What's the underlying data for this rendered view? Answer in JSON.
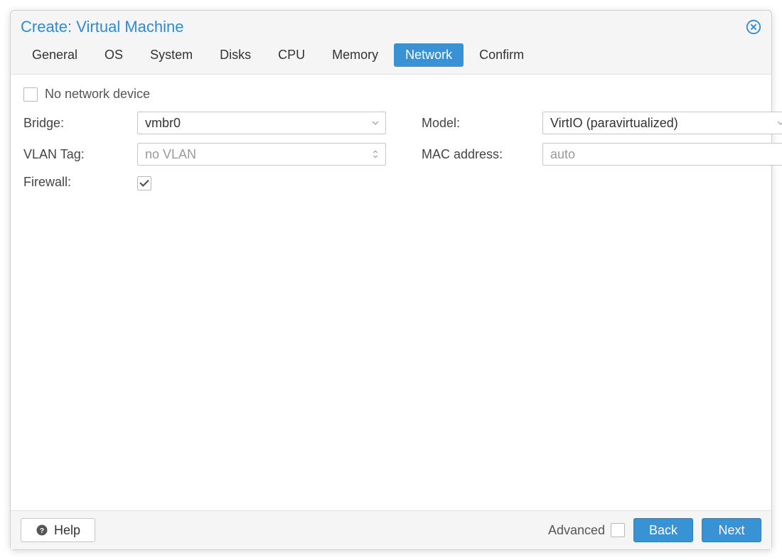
{
  "dialog": {
    "title": "Create: Virtual Machine"
  },
  "tabs": {
    "general": "General",
    "os": "OS",
    "system": "System",
    "disks": "Disks",
    "cpu": "CPU",
    "memory": "Memory",
    "network": "Network",
    "confirm": "Confirm",
    "active": "network"
  },
  "form": {
    "no_network_label": "No network device",
    "no_network_checked": false,
    "bridge": {
      "label": "Bridge:",
      "value": "vmbr0"
    },
    "vlan": {
      "label": "VLAN Tag:",
      "placeholder": "no VLAN"
    },
    "firewall": {
      "label": "Firewall:",
      "checked": true
    },
    "model": {
      "label": "Model:",
      "value": "VirtIO (paravirtualized)"
    },
    "mac": {
      "label": "MAC address:",
      "placeholder": "auto"
    }
  },
  "footer": {
    "help": "Help",
    "advanced": "Advanced",
    "advanced_checked": false,
    "back": "Back",
    "next": "Next"
  }
}
